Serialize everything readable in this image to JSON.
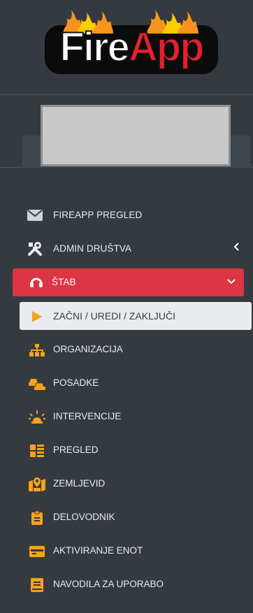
{
  "logo": {
    "part1": "Fire",
    "part2": "App"
  },
  "colors": {
    "sidebar": "#343a40",
    "active": "#dc3545",
    "accent": "#f7a21b",
    "selected": "#e9ecef"
  },
  "user_selector": {
    "icon": "chevron-down-icon"
  },
  "menu": {
    "fireapp_pregled": {
      "label": "FIREAPP PREGLED",
      "icon": "envelope-icon"
    },
    "admin_drustva": {
      "label": "ADMIN DRUŠTVA",
      "icon": "tools-icon",
      "caret": "chevron-left-icon"
    },
    "stab": {
      "label": "ŠTAB",
      "icon": "headset-icon",
      "caret": "chevron-down-icon"
    }
  },
  "submenu": [
    {
      "label": "ZAČNI / UREDI / ZAKLJUČI",
      "icon": "play-icon",
      "selected": true
    },
    {
      "label": "ORGANIZACIJA",
      "icon": "sitemap-icon"
    },
    {
      "label": "POSADKE",
      "icon": "cars-icon"
    },
    {
      "label": "INTERVENCIJE",
      "icon": "siren-icon"
    },
    {
      "label": "PREGLED",
      "icon": "th-list-icon"
    },
    {
      "label": "ZEMLJEVID",
      "icon": "map-marked-icon"
    },
    {
      "label": "DELOVODNIK",
      "icon": "clipboard-icon"
    },
    {
      "label": "AKTIVIRANJE ENOT",
      "icon": "credit-card-icon"
    },
    {
      "label": "NAVODILA ZA UPORABO",
      "icon": "book-icon"
    }
  ]
}
